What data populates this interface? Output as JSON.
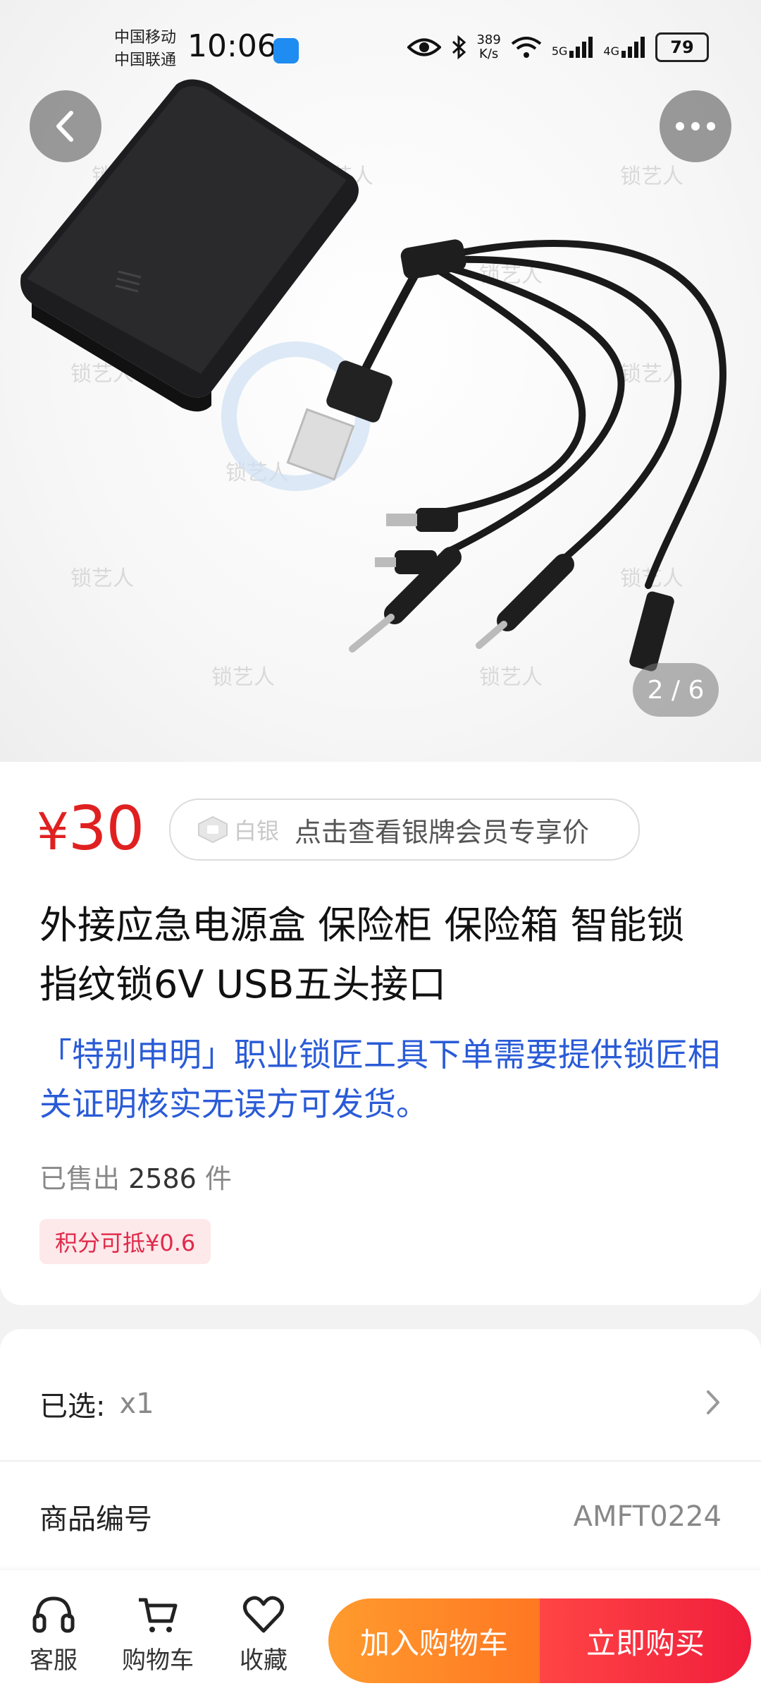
{
  "status_bar": {
    "carrier_1": "中国移动",
    "carrier_2": "中国联通",
    "time": "10:06",
    "net_speed_value": "389",
    "net_speed_unit": "K/s",
    "signal_1": "5G",
    "signal_2": "4G",
    "battery": "79"
  },
  "gallery": {
    "page_indicator": "2 / 6",
    "watermark": "锁艺人"
  },
  "product": {
    "price_symbol": "¥",
    "price": "30",
    "member_tag": "白银",
    "member_text": "点击查看银牌会员专享价",
    "title": "外接应急电源盒 保险柜 保险箱 智能锁 指纹锁6V USB五头接口",
    "notice": "「特别申明」职业锁匠工具下单需要提供锁匠相关证明核实无误方可发货。",
    "sold_prefix": "已售出",
    "sold_count": "2586",
    "sold_unit": "件",
    "points_tag": "积分可抵¥0.6"
  },
  "options": {
    "selected_label": "已选:",
    "selected_value": "x1",
    "sku_label": "商品编号",
    "sku_value": "AMFT0224"
  },
  "bottom_bar": {
    "service": "客服",
    "cart": "购物车",
    "favorite": "收藏",
    "add_to_cart": "加入购物车",
    "buy_now": "立即购买"
  },
  "colors": {
    "price_red": "#e02020",
    "notice_blue": "#2a5bd7",
    "cart_orange": "#ff8a26",
    "buy_red": "#f0283c"
  }
}
